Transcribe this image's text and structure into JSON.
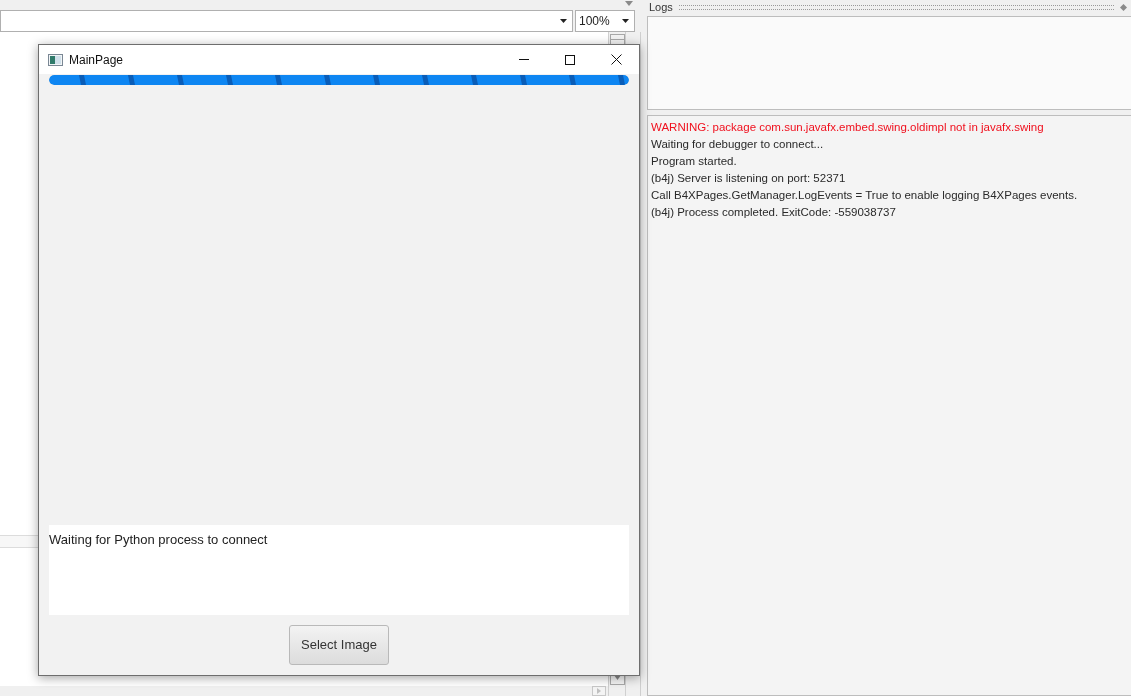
{
  "ide": {
    "zoom_dropdown": {
      "value": "100%"
    }
  },
  "logs": {
    "title": "Logs",
    "lines": [
      {
        "kind": "warning",
        "text": "WARNING: package com.sun.javafx.embed.swing.oldimpl not in javafx.swing"
      },
      {
        "kind": "info",
        "text": "Waiting for debugger to connect..."
      },
      {
        "kind": "info",
        "text": "Program started."
      },
      {
        "kind": "info",
        "text": "(b4j) Server is listening on port: 52371"
      },
      {
        "kind": "info",
        "text": "Call B4XPages.GetManager.LogEvents = True to enable logging B4XPages events."
      },
      {
        "kind": "info",
        "text": "(b4j) Process completed. ExitCode: -559038737"
      }
    ]
  },
  "dialog": {
    "title": "MainPage",
    "progress_bar": {
      "level": 1,
      "indeterminate": true
    },
    "status_text": "Waiting for Python process to connect",
    "button": "Select Image"
  }
}
